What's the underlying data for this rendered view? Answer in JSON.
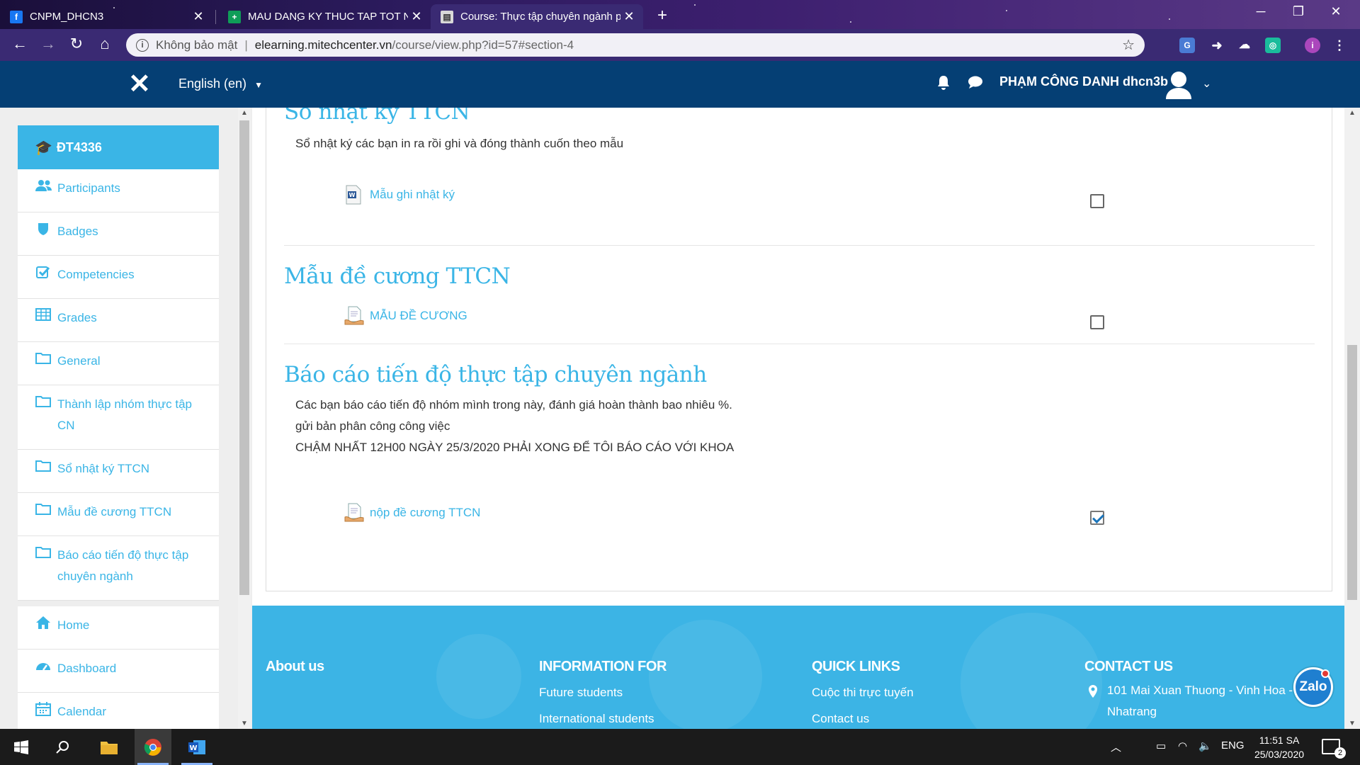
{
  "browser": {
    "tabs": [
      {
        "title": "CNPM_DHCN3",
        "favicon": "facebook-icon",
        "favicon_color": "#1877f2",
        "active": false
      },
      {
        "title": "MAU DANG KY THUC TAP TOT N",
        "favicon": "sheets-icon",
        "favicon_color": "#0f9d58",
        "active": false
      },
      {
        "title": "Course: Thực tập chuyên ngành p",
        "favicon": "moodle-icon",
        "favicon_color": "#d9d9d9",
        "active": true
      }
    ],
    "security_label": "Không bảo mật",
    "url_host": "elearning.mitechcenter.vn",
    "url_path": "/course/view.php?id=57#section-4"
  },
  "navbar": {
    "language": "English (en)",
    "user_name": "PHẠM CÔNG DANH dhcn3b"
  },
  "drawer": {
    "course": "ĐT4336",
    "items": [
      {
        "label": "Participants",
        "icon": "users-icon"
      },
      {
        "label": "Badges",
        "icon": "shield-icon"
      },
      {
        "label": "Competencies",
        "icon": "check-square-icon"
      },
      {
        "label": "Grades",
        "icon": "table-icon"
      },
      {
        "label": "General",
        "icon": "folder-icon"
      },
      {
        "label": "Thành lập nhóm thực tập CN",
        "icon": "folder-icon"
      },
      {
        "label": "Sổ nhật ký TTCN",
        "icon": "folder-icon"
      },
      {
        "label": "Mẫu đề cương TTCN",
        "icon": "folder-icon"
      },
      {
        "label": "Báo cáo tiến độ thực tập chuyên ngành",
        "icon": "folder-icon"
      }
    ],
    "nav": [
      {
        "label": "Home",
        "icon": "home-icon"
      },
      {
        "label": "Dashboard",
        "icon": "dashboard-icon"
      },
      {
        "label": "Calendar",
        "icon": "calendar-icon"
      }
    ]
  },
  "sections": [
    {
      "title": "Sổ nhật ký TTCN",
      "summary": [
        "Sổ nhật ký các bạn in ra rồi ghi và đóng thành cuốn theo mẫu"
      ],
      "activity": {
        "label": "Mẫu ghi nhật ký",
        "icon": "word-file-icon",
        "completed": false
      }
    },
    {
      "title": "Mẫu đề cương TTCN",
      "summary": [],
      "activity": {
        "label": "MẪU ĐỀ CƯƠNG",
        "icon": "assignment-icon",
        "completed": false
      }
    },
    {
      "title": "Báo cáo tiến độ thực tập chuyên ngành",
      "summary": [
        "Các bạn báo cáo tiến độ nhóm mình trong này, đánh giá hoàn thành bao nhiêu %.",
        "gửi bản phân công công việc",
        "CHẬM NHẤT 12H00 NGÀY 25/3/2020 PHẢI XONG ĐỂ TÔI BÁO CÁO VỚI KHOA"
      ],
      "activity": {
        "label": "nộp đề cương TTCN",
        "icon": "assignment-icon",
        "completed": true
      }
    }
  ],
  "footer": {
    "about_heading": "About us",
    "info_heading": "INFORMATION FOR",
    "info_links": [
      "Future students",
      "International students"
    ],
    "quick_heading": "QUICK LINKS",
    "quick_links": [
      "Cuộc thi trực tuyến",
      "Contact us"
    ],
    "contact_heading": "CONTACT US",
    "address_line1": "101 Mai Xuan Thuong - Vinh Hoa -",
    "address_line2": "Nhatrang",
    "chat_widget": "Zalo"
  },
  "taskbar": {
    "language": "ENG",
    "time": "11:51 SA",
    "date": "25/03/2020",
    "notifications": "2"
  },
  "colors": {
    "accent": "#3ab5e6",
    "navbar": "#053f74",
    "browser_frame": "#3a2a73",
    "footer": "#3cb4e5"
  }
}
